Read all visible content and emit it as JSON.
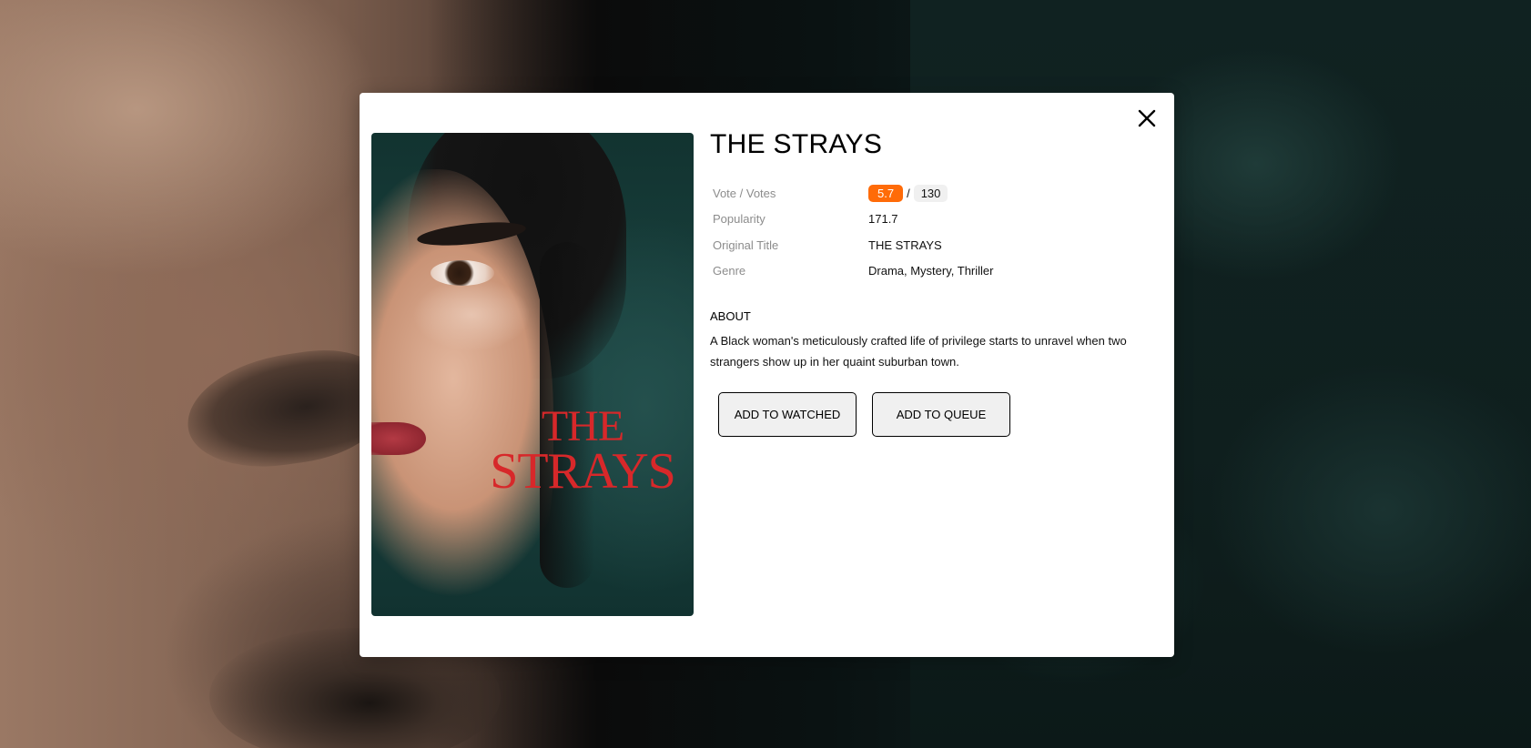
{
  "modal": {
    "title": "THE STRAYS",
    "poster": {
      "title_line1": "THE",
      "title_line2": "STRAYS",
      "title_color": "#d7282a"
    },
    "close_icon": "close-icon",
    "info": {
      "vote_label": "Vote / Votes",
      "vote": "5.7",
      "votes_separator": "/",
      "votes": "130",
      "popularity_label": "Popularity",
      "popularity": "171.7",
      "original_title_label": "Original Title",
      "original_title": "THE STRAYS",
      "genre_label": "Genre",
      "genre": "Drama, Mystery, Thriller"
    },
    "about_heading": "ABOUT",
    "about_text": "A Black woman's meticulously crafted life of privilege starts to unravel when two strangers show up in her quaint suburban town.",
    "buttons": {
      "watched": "ADD TO WATCHED",
      "queue": "ADD TO QUEUE"
    }
  },
  "colors": {
    "vote_badge": "#ff6b08",
    "votes_badge": "#f0f0f0",
    "button_bg": "#f0f0f0"
  }
}
